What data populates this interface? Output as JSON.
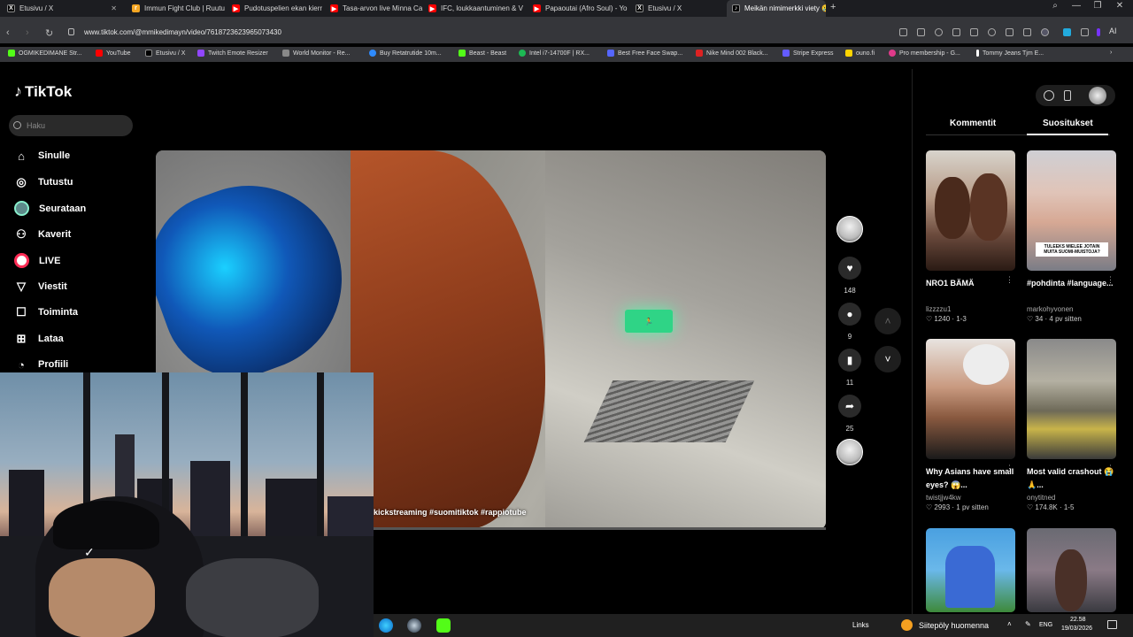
{
  "browser": {
    "tabs": [
      {
        "label": "Etusivu / X",
        "fav": "X",
        "color": "#000000"
      },
      {
        "label": "Immun Fight Club | Ruutu",
        "fav": "r",
        "color": "#f5a623"
      },
      {
        "label": "Pudotuspelien ekan kierr",
        "fav": "▶",
        "color": "#ff0000"
      },
      {
        "label": "Tasa-arvon live Minna Ca",
        "fav": "▶",
        "color": "#ff0000"
      },
      {
        "label": "IFC, loukkaantuminen & V",
        "fav": "▶",
        "color": "#ff0000"
      },
      {
        "label": "Papaoutai (Afro Soul) - Yo",
        "fav": "▶",
        "color": "#ff0000"
      },
      {
        "label": "Etusivu / X",
        "fav": "X",
        "color": "#000000"
      },
      {
        "label": "Meikän nimimerkki viety 😢",
        "fav": "♪",
        "color": "#000000"
      }
    ],
    "url": "www.tiktok.com/@mmikedimayn/video/7618723623965073430",
    "ai_label": "AI",
    "bookmarks": [
      {
        "label": "OGMIKEDIMANE Str...",
        "color": "#53fc18"
      },
      {
        "label": "YouTube",
        "color": "#ff0000"
      },
      {
        "label": "Etusivu / X",
        "color": "#000000"
      },
      {
        "label": "Twitch Emote Resizer",
        "color": "#9146ff"
      },
      {
        "label": "World Monitor - Re...",
        "color": "#888888"
      },
      {
        "label": "Buy Retatrutide 10m...",
        "color": "#2e8bff"
      },
      {
        "label": "Beast - Beast",
        "color": "#53fc18"
      },
      {
        "label": "Intel i7-14700F | RX...",
        "color": "#3aa0ff"
      },
      {
        "label": "Best Free Face Swap...",
        "color": "#5566ff"
      },
      {
        "label": "Nike Mind 002 Black...",
        "color": "#dd2222"
      },
      {
        "label": "Stripe Express",
        "color": "#635bff"
      },
      {
        "label": "ouno.fi",
        "color": "#ffd400"
      },
      {
        "label": "Pro membership - G...",
        "color": "#e03a8a"
      },
      {
        "label": "Tommy Jeans Tjm E...",
        "color": "#ffffff"
      }
    ]
  },
  "tiktok": {
    "logo": "TikTok",
    "search_placeholder": "Haku",
    "nav": [
      {
        "label": "Sinulle",
        "icon": "home-icon"
      },
      {
        "label": "Tutustu",
        "icon": "compass-icon"
      },
      {
        "label": "Seurataan",
        "icon": "following-avatar-icon"
      },
      {
        "label": "Kaverit",
        "icon": "friends-icon"
      },
      {
        "label": "LIVE",
        "icon": "live-icon"
      },
      {
        "label": "Viestit",
        "icon": "messages-icon"
      },
      {
        "label": "Toiminta",
        "icon": "activity-icon"
      },
      {
        "label": "Lataa",
        "icon": "upload-icon"
      },
      {
        "label": "Profiili",
        "icon": "profile-icon"
      }
    ],
    "video": {
      "caption": "kickstreaming #suomitiktok #rappiotube",
      "progress": 0.0
    },
    "actions": {
      "likes": "148",
      "comments": "9",
      "saves": "11",
      "shares": "25"
    },
    "right_panel": {
      "tabs": [
        "Kommentit",
        "Suositukset"
      ],
      "active_tab": "Suositukset",
      "cards": [
        {
          "title": "NRO1 BÄMÄ",
          "author": "lizzzzu1",
          "meta": "♡ 1240 · 1-3"
        },
        {
          "title": "#pohdinta #language...",
          "author": "markohyvonen",
          "meta": "♡ 34 · 4 pv sitten",
          "overlay": "TULEEKS MIELEE JOTAIN MUITA SUOMI-MUISTOJA?"
        },
        {
          "title": "Why Asians have small eyes? 😱...",
          "author": "twistjjw4kw",
          "meta": "♡ 2993 · 1 pv sitten"
        },
        {
          "title": "Most valid crashout 😭🙏...",
          "author": "onytitned",
          "meta": "♡ 174.8K · 1-5"
        }
      ]
    }
  },
  "taskbar": {
    "links": "Links",
    "weather": "Siitepöly huomenna",
    "lang": "ENG",
    "time": "22.58",
    "date": "19/03/2026"
  }
}
